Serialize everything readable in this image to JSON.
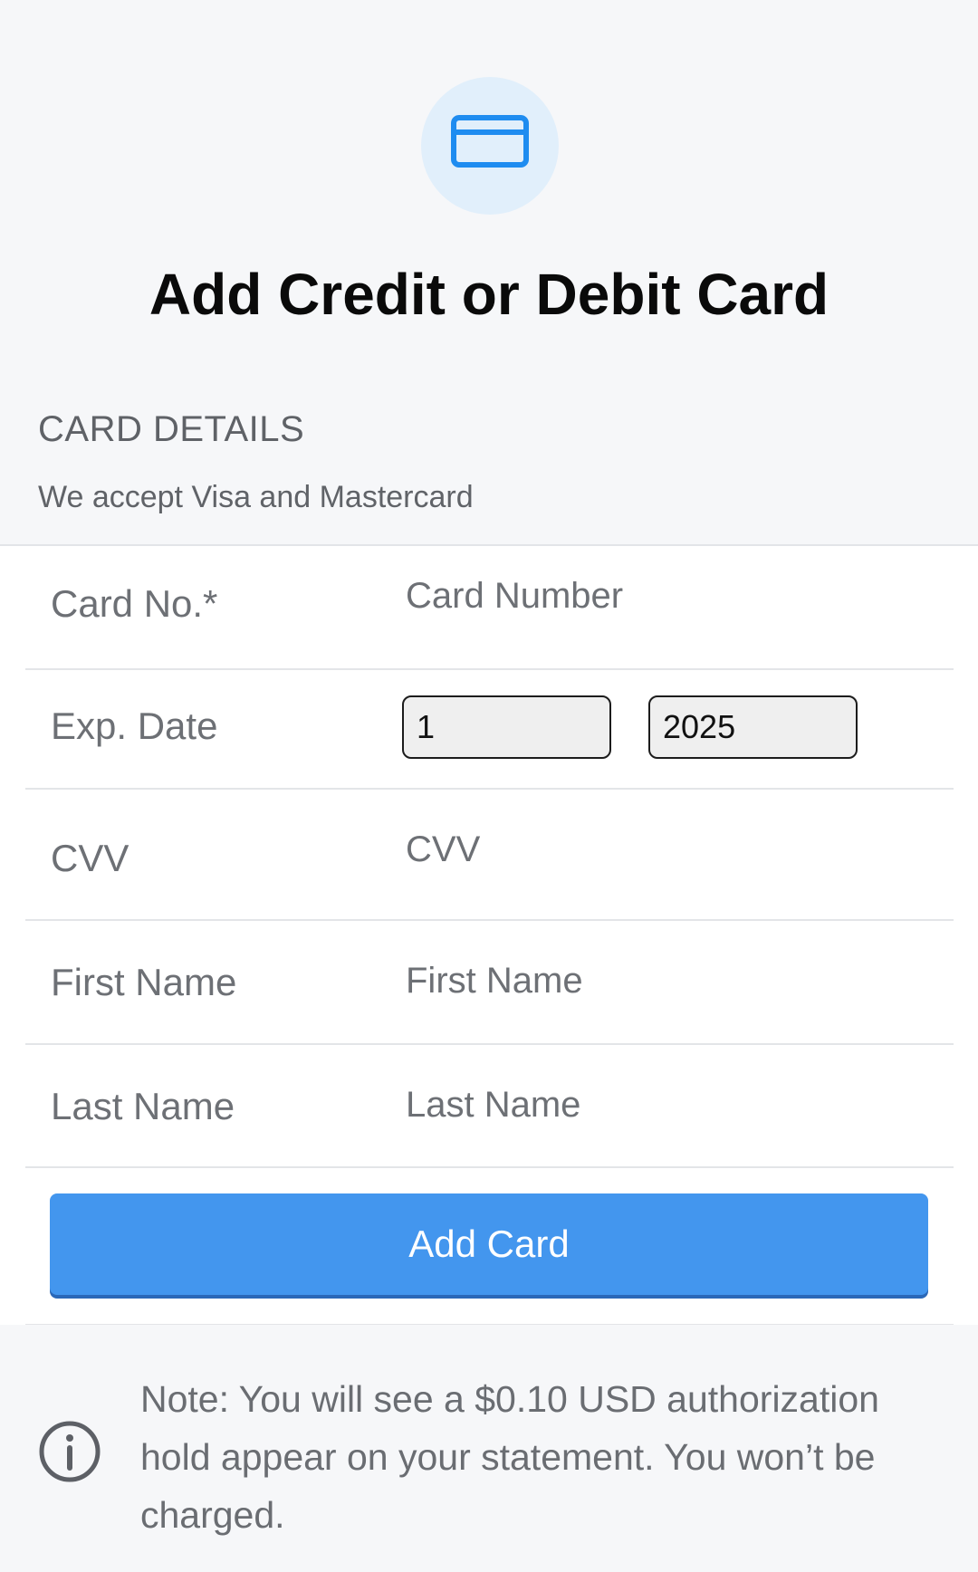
{
  "header": {
    "icon": "credit-card-icon",
    "title": "Add Credit or Debit Card"
  },
  "section": {
    "title": "CARD DETAILS",
    "subtitle": "We accept Visa and Mastercard"
  },
  "form": {
    "card_number": {
      "label": "Card No.*",
      "placeholder": "Card Number"
    },
    "exp_date": {
      "label": "Exp. Date",
      "month": "1",
      "year": "2025"
    },
    "cvv": {
      "label": "CVV",
      "placeholder": "CVV"
    },
    "first_name": {
      "label": "First Name",
      "placeholder": "First Name"
    },
    "last_name": {
      "label": "Last Name",
      "placeholder": "Last Name"
    },
    "submit_label": "Add Card"
  },
  "note": {
    "icon": "info-icon",
    "text": "Note: You will see a $0.10 USD authorization hold appear on your statement. You won’t be charged."
  },
  "colors": {
    "accent": "#4396ee",
    "icon_bg": "#e1effb",
    "icon_stroke": "#1e8cf0",
    "page_bg": "#f6f7f9"
  }
}
